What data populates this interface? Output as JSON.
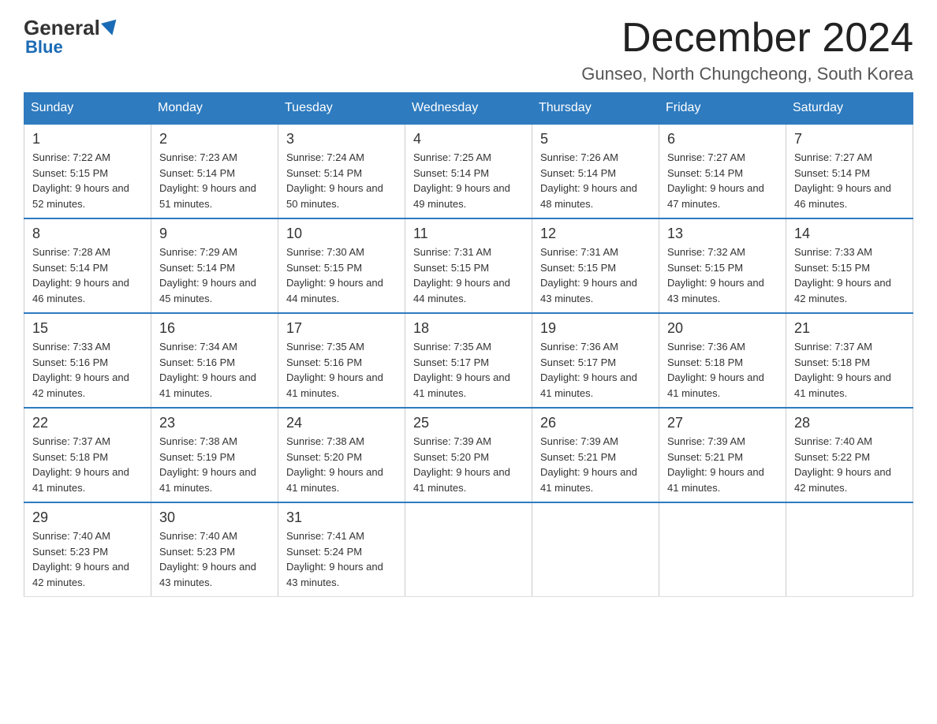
{
  "logo": {
    "general": "General",
    "triangle": "",
    "blue": "Blue"
  },
  "header": {
    "month_title": "December 2024",
    "location": "Gunseo, North Chungcheong, South Korea"
  },
  "days_of_week": [
    "Sunday",
    "Monday",
    "Tuesday",
    "Wednesday",
    "Thursday",
    "Friday",
    "Saturday"
  ],
  "weeks": [
    [
      {
        "day": "1",
        "sunrise": "Sunrise: 7:22 AM",
        "sunset": "Sunset: 5:15 PM",
        "daylight": "Daylight: 9 hours and 52 minutes."
      },
      {
        "day": "2",
        "sunrise": "Sunrise: 7:23 AM",
        "sunset": "Sunset: 5:14 PM",
        "daylight": "Daylight: 9 hours and 51 minutes."
      },
      {
        "day": "3",
        "sunrise": "Sunrise: 7:24 AM",
        "sunset": "Sunset: 5:14 PM",
        "daylight": "Daylight: 9 hours and 50 minutes."
      },
      {
        "day": "4",
        "sunrise": "Sunrise: 7:25 AM",
        "sunset": "Sunset: 5:14 PM",
        "daylight": "Daylight: 9 hours and 49 minutes."
      },
      {
        "day": "5",
        "sunrise": "Sunrise: 7:26 AM",
        "sunset": "Sunset: 5:14 PM",
        "daylight": "Daylight: 9 hours and 48 minutes."
      },
      {
        "day": "6",
        "sunrise": "Sunrise: 7:27 AM",
        "sunset": "Sunset: 5:14 PM",
        "daylight": "Daylight: 9 hours and 47 minutes."
      },
      {
        "day": "7",
        "sunrise": "Sunrise: 7:27 AM",
        "sunset": "Sunset: 5:14 PM",
        "daylight": "Daylight: 9 hours and 46 minutes."
      }
    ],
    [
      {
        "day": "8",
        "sunrise": "Sunrise: 7:28 AM",
        "sunset": "Sunset: 5:14 PM",
        "daylight": "Daylight: 9 hours and 46 minutes."
      },
      {
        "day": "9",
        "sunrise": "Sunrise: 7:29 AM",
        "sunset": "Sunset: 5:14 PM",
        "daylight": "Daylight: 9 hours and 45 minutes."
      },
      {
        "day": "10",
        "sunrise": "Sunrise: 7:30 AM",
        "sunset": "Sunset: 5:15 PM",
        "daylight": "Daylight: 9 hours and 44 minutes."
      },
      {
        "day": "11",
        "sunrise": "Sunrise: 7:31 AM",
        "sunset": "Sunset: 5:15 PM",
        "daylight": "Daylight: 9 hours and 44 minutes."
      },
      {
        "day": "12",
        "sunrise": "Sunrise: 7:31 AM",
        "sunset": "Sunset: 5:15 PM",
        "daylight": "Daylight: 9 hours and 43 minutes."
      },
      {
        "day": "13",
        "sunrise": "Sunrise: 7:32 AM",
        "sunset": "Sunset: 5:15 PM",
        "daylight": "Daylight: 9 hours and 43 minutes."
      },
      {
        "day": "14",
        "sunrise": "Sunrise: 7:33 AM",
        "sunset": "Sunset: 5:15 PM",
        "daylight": "Daylight: 9 hours and 42 minutes."
      }
    ],
    [
      {
        "day": "15",
        "sunrise": "Sunrise: 7:33 AM",
        "sunset": "Sunset: 5:16 PM",
        "daylight": "Daylight: 9 hours and 42 minutes."
      },
      {
        "day": "16",
        "sunrise": "Sunrise: 7:34 AM",
        "sunset": "Sunset: 5:16 PM",
        "daylight": "Daylight: 9 hours and 41 minutes."
      },
      {
        "day": "17",
        "sunrise": "Sunrise: 7:35 AM",
        "sunset": "Sunset: 5:16 PM",
        "daylight": "Daylight: 9 hours and 41 minutes."
      },
      {
        "day": "18",
        "sunrise": "Sunrise: 7:35 AM",
        "sunset": "Sunset: 5:17 PM",
        "daylight": "Daylight: 9 hours and 41 minutes."
      },
      {
        "day": "19",
        "sunrise": "Sunrise: 7:36 AM",
        "sunset": "Sunset: 5:17 PM",
        "daylight": "Daylight: 9 hours and 41 minutes."
      },
      {
        "day": "20",
        "sunrise": "Sunrise: 7:36 AM",
        "sunset": "Sunset: 5:18 PM",
        "daylight": "Daylight: 9 hours and 41 minutes."
      },
      {
        "day": "21",
        "sunrise": "Sunrise: 7:37 AM",
        "sunset": "Sunset: 5:18 PM",
        "daylight": "Daylight: 9 hours and 41 minutes."
      }
    ],
    [
      {
        "day": "22",
        "sunrise": "Sunrise: 7:37 AM",
        "sunset": "Sunset: 5:18 PM",
        "daylight": "Daylight: 9 hours and 41 minutes."
      },
      {
        "day": "23",
        "sunrise": "Sunrise: 7:38 AM",
        "sunset": "Sunset: 5:19 PM",
        "daylight": "Daylight: 9 hours and 41 minutes."
      },
      {
        "day": "24",
        "sunrise": "Sunrise: 7:38 AM",
        "sunset": "Sunset: 5:20 PM",
        "daylight": "Daylight: 9 hours and 41 minutes."
      },
      {
        "day": "25",
        "sunrise": "Sunrise: 7:39 AM",
        "sunset": "Sunset: 5:20 PM",
        "daylight": "Daylight: 9 hours and 41 minutes."
      },
      {
        "day": "26",
        "sunrise": "Sunrise: 7:39 AM",
        "sunset": "Sunset: 5:21 PM",
        "daylight": "Daylight: 9 hours and 41 minutes."
      },
      {
        "day": "27",
        "sunrise": "Sunrise: 7:39 AM",
        "sunset": "Sunset: 5:21 PM",
        "daylight": "Daylight: 9 hours and 41 minutes."
      },
      {
        "day": "28",
        "sunrise": "Sunrise: 7:40 AM",
        "sunset": "Sunset: 5:22 PM",
        "daylight": "Daylight: 9 hours and 42 minutes."
      }
    ],
    [
      {
        "day": "29",
        "sunrise": "Sunrise: 7:40 AM",
        "sunset": "Sunset: 5:23 PM",
        "daylight": "Daylight: 9 hours and 42 minutes."
      },
      {
        "day": "30",
        "sunrise": "Sunrise: 7:40 AM",
        "sunset": "Sunset: 5:23 PM",
        "daylight": "Daylight: 9 hours and 43 minutes."
      },
      {
        "day": "31",
        "sunrise": "Sunrise: 7:41 AM",
        "sunset": "Sunset: 5:24 PM",
        "daylight": "Daylight: 9 hours and 43 minutes."
      },
      null,
      null,
      null,
      null
    ]
  ]
}
